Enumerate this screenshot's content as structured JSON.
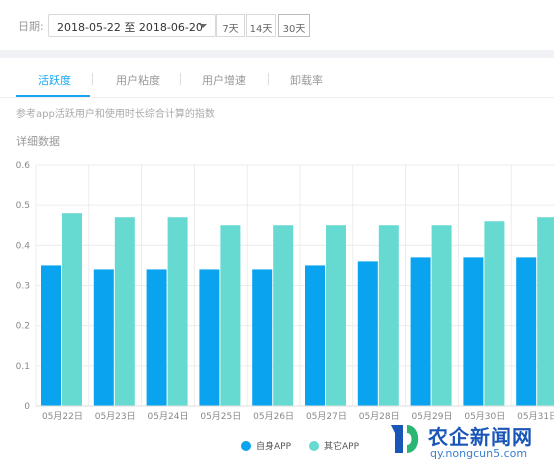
{
  "filter": {
    "date_label": "日期:",
    "date_range": "2018-05-22 至 2018-06-20",
    "quick_ranges": [
      "7天",
      "14天",
      "30天"
    ]
  },
  "tabs": [
    {
      "label": "活跃度",
      "active": true
    },
    {
      "label": "用户粘度",
      "active": false
    },
    {
      "label": "用户增速",
      "active": false
    },
    {
      "label": "卸载率",
      "active": false
    }
  ],
  "description": "参考app活跃用户和使用时长综合计算的指数",
  "section_title": "详细数据",
  "colors": {
    "accent": "#1aa6f1",
    "series_self": "#0aa3ef",
    "series_other": "#66d9d0"
  },
  "chart_data": {
    "type": "bar",
    "categories": [
      "05月22日",
      "05月23日",
      "05月24日",
      "05月25日",
      "05月26日",
      "05月27日",
      "05月28日",
      "05月29日",
      "05月30日",
      "05月31日"
    ],
    "series": [
      {
        "name": "自身APP",
        "values": [
          0.35,
          0.34,
          0.34,
          0.34,
          0.34,
          0.35,
          0.36,
          0.37,
          0.37,
          0.37
        ]
      },
      {
        "name": "其它APP",
        "values": [
          0.48,
          0.47,
          0.47,
          0.45,
          0.45,
          0.45,
          0.45,
          0.45,
          0.46,
          0.47
        ]
      }
    ],
    "yticks": [
      "0",
      "0.1",
      "0.2",
      "0.3",
      "0.4",
      "0.5",
      "0.6"
    ],
    "ylim": [
      0,
      0.6
    ],
    "grid": true,
    "legend_position": "bottom-center"
  },
  "watermark": {
    "title": "农企新闻网",
    "url": "qy.nongcun5.com"
  }
}
